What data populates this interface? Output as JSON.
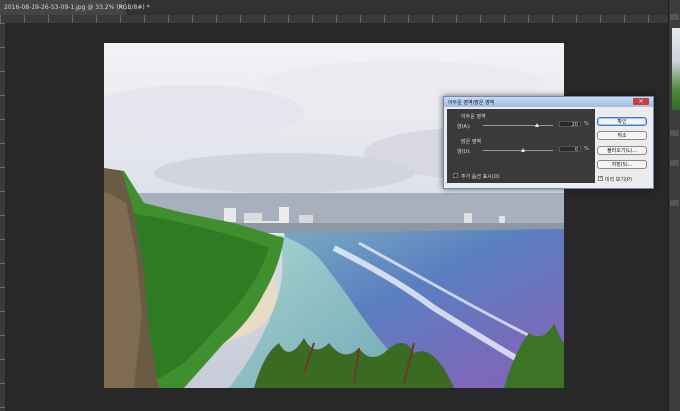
{
  "document_tab": {
    "title": "2016-08-19-26-53-09-1.jpg @ 33.2% (RGB/8#) *",
    "close_glyph": "×"
  },
  "dialog": {
    "title": "어두운 영역/밝은 영역",
    "close_glyph": "✕",
    "shadows": {
      "group_label": "어두운 영역",
      "amount_label": "양(A):",
      "amount_value": "20",
      "amount_fraction": 0.2,
      "unit": "%"
    },
    "highlights": {
      "group_label": "밝은 영역",
      "amount_label": "양(U):",
      "amount_value": "0",
      "amount_fraction": 0.0,
      "unit": "%"
    },
    "more_options_label": "추가 옵션 표시(O)",
    "buttons": {
      "ok": "확인",
      "cancel": "취소",
      "load": "불러오기(L)...",
      "save": "저장(S)..."
    },
    "preview_label": "미리 보기(P)",
    "preview_checked": true,
    "more_options_checked": false
  },
  "colors": {
    "workspace_bg": "#282828",
    "dialog_title_bg": "#9fbde6",
    "close_button": "#c8403a"
  }
}
